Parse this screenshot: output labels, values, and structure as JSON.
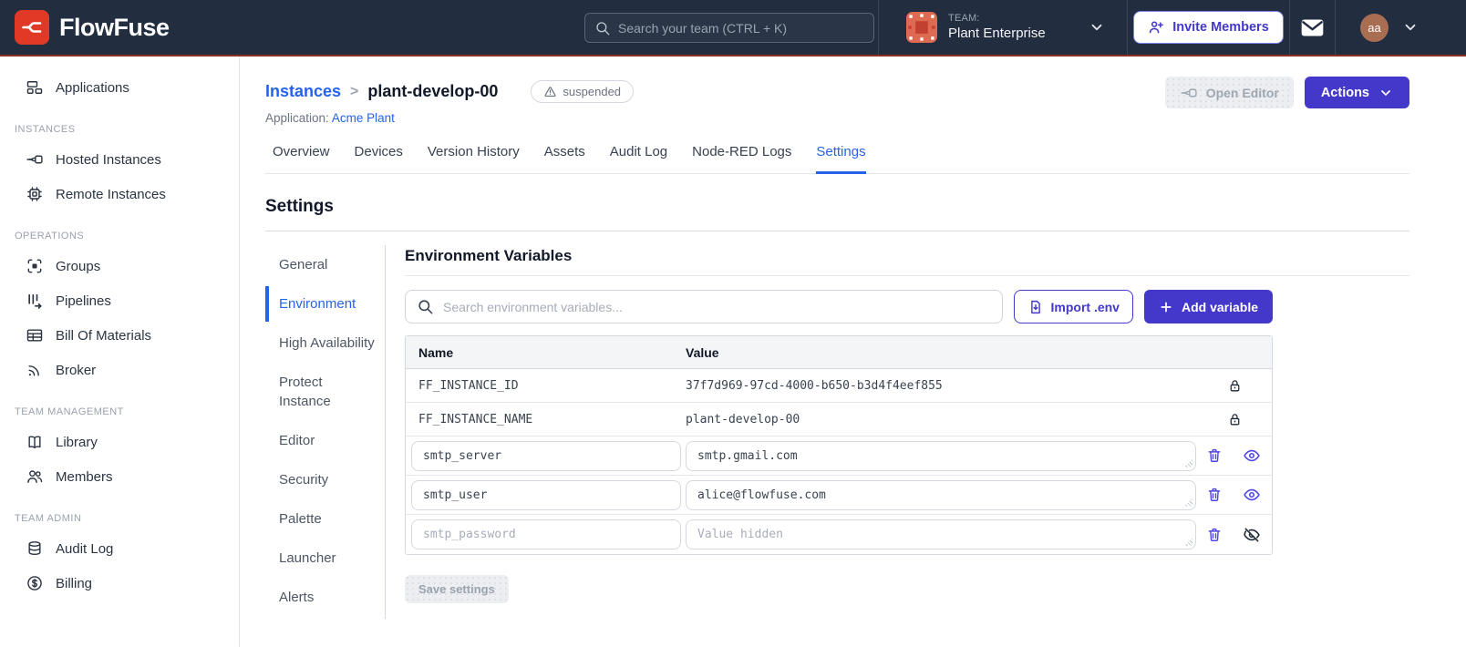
{
  "colors": {
    "navbar_bg": "#222D40",
    "navbar_accent_line": "#8C2E24",
    "brand_red": "#E03A26",
    "accent_indigo": "#4338CA",
    "link_blue": "#2563EB",
    "text_dark": "#111827",
    "muted_gray": "#6B7280",
    "border_gray": "#D5D9DF",
    "table_header_bg": "#F4F5F7",
    "team_avatar_salmon": "#DF6A52",
    "user_avatar_brown": "#A96E52"
  },
  "navbar": {
    "brand": "FlowFuse",
    "search_placeholder": "Search your team (CTRL + K)",
    "team_label": "TEAM:",
    "team_name": "Plant Enterprise",
    "invite_label": "Invite Members",
    "avatar_initials": "aa"
  },
  "sidebar": {
    "top_item": "Applications",
    "sections": [
      {
        "title": "INSTANCES",
        "items": [
          "Hosted Instances",
          "Remote Instances"
        ]
      },
      {
        "title": "OPERATIONS",
        "items": [
          "Groups",
          "Pipelines",
          "Bill Of Materials",
          "Broker"
        ]
      },
      {
        "title": "TEAM MANAGEMENT",
        "items": [
          "Library",
          "Members"
        ]
      },
      {
        "title": "TEAM ADMIN",
        "items": [
          "Audit Log",
          "Billing"
        ]
      }
    ]
  },
  "header": {
    "breadcrumb": "Instances",
    "separator": ">",
    "instance_name": "plant-develop-00",
    "status": "suspended",
    "application_label": "Application:",
    "application_name": "Acme Plant",
    "open_editor_label": "Open Editor",
    "actions_label": "Actions"
  },
  "tabs": [
    "Overview",
    "Devices",
    "Version History",
    "Assets",
    "Audit Log",
    "Node-RED Logs",
    "Settings"
  ],
  "settings": {
    "title": "Settings",
    "nav": [
      "General",
      "Environment",
      "High Availability",
      "Protect Instance",
      "Editor",
      "Security",
      "Palette",
      "Launcher",
      "Alerts"
    ]
  },
  "env": {
    "title": "Environment Variables",
    "search_placeholder": "Search environment variables...",
    "import_label": "Import .env",
    "add_label": "Add variable",
    "col_name": "Name",
    "col_value": "Value",
    "locked_rows": [
      {
        "name": "FF_INSTANCE_ID",
        "value": "37f7d969-97cd-4000-b650-b3d4f4eef855"
      },
      {
        "name": "FF_INSTANCE_NAME",
        "value": "plant-develop-00"
      }
    ],
    "rows": [
      {
        "name": "smtp_server",
        "value": "smtp.gmail.com"
      },
      {
        "name": "smtp_user",
        "value": "alice@flowfuse.com"
      },
      {
        "name": "smtp_password",
        "value": "",
        "placeholder": "Value hidden"
      }
    ],
    "save_label": "Save settings"
  }
}
